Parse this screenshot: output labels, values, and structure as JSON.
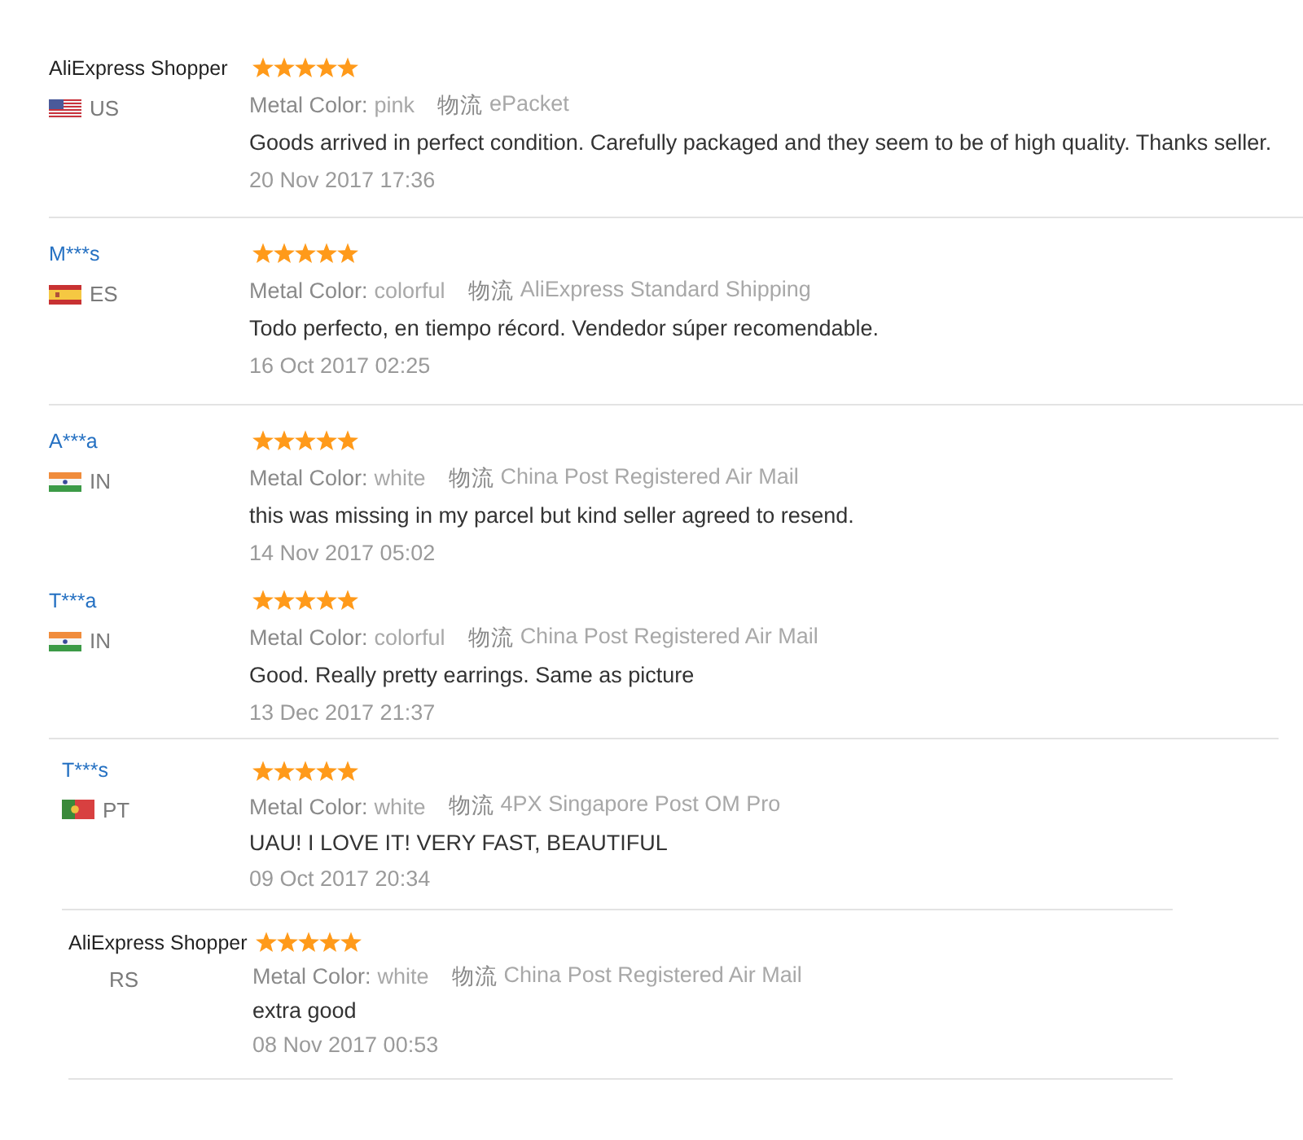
{
  "reviews": [
    {
      "name": "AliExpress Shopper",
      "linked": false,
      "flag": {
        "kind": "us"
      },
      "country": "US",
      "stars": 5,
      "attributes": [
        {
          "label": "Metal Color:",
          "value": "pink"
        },
        {
          "label": "物流",
          "value": "ePacket"
        }
      ],
      "text": "Goods arrived in perfect condition. Carefully packaged and they seem to be of high quality. Thanks seller.",
      "date": "20 Nov 2017 17:36"
    },
    {
      "name": "M***s",
      "linked": true,
      "flag": {
        "kind": "es"
      },
      "country": "ES",
      "stars": 5,
      "attributes": [
        {
          "label": "Metal Color:",
          "value": "colorful"
        },
        {
          "label": "物流",
          "value": "AliExpress Standard Shipping"
        }
      ],
      "text": "Todo perfecto, en tiempo récord. Vendedor súper recomendable.",
      "date": "16 Oct 2017 02:25"
    },
    {
      "name": "A***a",
      "linked": true,
      "flag": {
        "kind": "in"
      },
      "country": "IN",
      "stars": 5,
      "attributes": [
        {
          "label": "Metal Color:",
          "value": "white"
        },
        {
          "label": "物流",
          "value": "China Post Registered Air Mail"
        }
      ],
      "text": "this was missing in my parcel but kind seller agreed to resend.",
      "date": "14 Nov 2017 05:02"
    },
    {
      "name": "T***a",
      "linked": true,
      "flag": {
        "kind": "in"
      },
      "country": "IN",
      "stars": 5,
      "attributes": [
        {
          "label": "Metal Color:",
          "value": "colorful"
        },
        {
          "label": "物流",
          "value": "China Post Registered Air Mail"
        }
      ],
      "text": "Good. Really pretty earrings. Same as picture",
      "date": "13 Dec 2017 21:37"
    },
    {
      "name": "T***s",
      "linked": true,
      "flag": {
        "kind": "pt"
      },
      "country": "PT",
      "stars": 5,
      "attributes": [
        {
          "label": "Metal Color:",
          "value": "white"
        },
        {
          "label": "物流",
          "value": "4PX Singapore Post OM Pro"
        }
      ],
      "text": "UAU! I LOVE IT! VERY FAST, BEAUTIFUL",
      "date": "09 Oct 2017 20:34"
    },
    {
      "name": "AliExpress Shopper",
      "linked": false,
      "country": "RS",
      "stars": 5,
      "attributes": [
        {
          "label": "Metal Color:",
          "value": "white"
        },
        {
          "label": "物流",
          "value": "China Post Registered Air Mail"
        }
      ],
      "text": "extra good",
      "date": "08 Nov 2017 00:53"
    }
  ]
}
